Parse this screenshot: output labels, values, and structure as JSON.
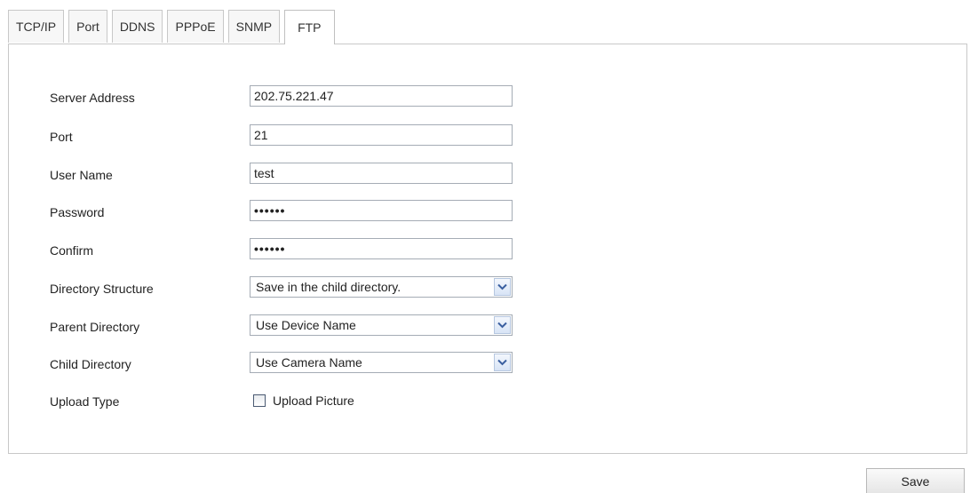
{
  "tabs": [
    {
      "label": "TCP/IP"
    },
    {
      "label": "Port"
    },
    {
      "label": "DDNS"
    },
    {
      "label": "PPPoE"
    },
    {
      "label": "SNMP"
    },
    {
      "label": "FTP",
      "active": true
    }
  ],
  "form": {
    "server_address": {
      "label": "Server Address",
      "value": "202.75.221.47"
    },
    "port": {
      "label": "Port",
      "value": "21"
    },
    "user_name": {
      "label": "User Name",
      "value": "test"
    },
    "password": {
      "label": "Password",
      "value": "••••••"
    },
    "confirm": {
      "label": "Confirm",
      "value": "••••••"
    },
    "directory_structure": {
      "label": "Directory Structure",
      "selected": "Save in the child directory."
    },
    "parent_directory": {
      "label": "Parent Directory",
      "selected": "Use Device Name"
    },
    "child_directory": {
      "label": "Child Directory",
      "selected": "Use Camera Name"
    },
    "upload_type": {
      "label": "Upload Type",
      "option_label": "Upload Picture",
      "checked": false
    }
  },
  "save_label": "Save",
  "icons": {
    "dropdown": "chevron-down-icon",
    "checkbox": "checkbox-unchecked-icon"
  },
  "colors": {
    "border": "#c8c8c8",
    "input_border": "#a5acb5",
    "dropdown_arrow": "#3a5fa0"
  }
}
